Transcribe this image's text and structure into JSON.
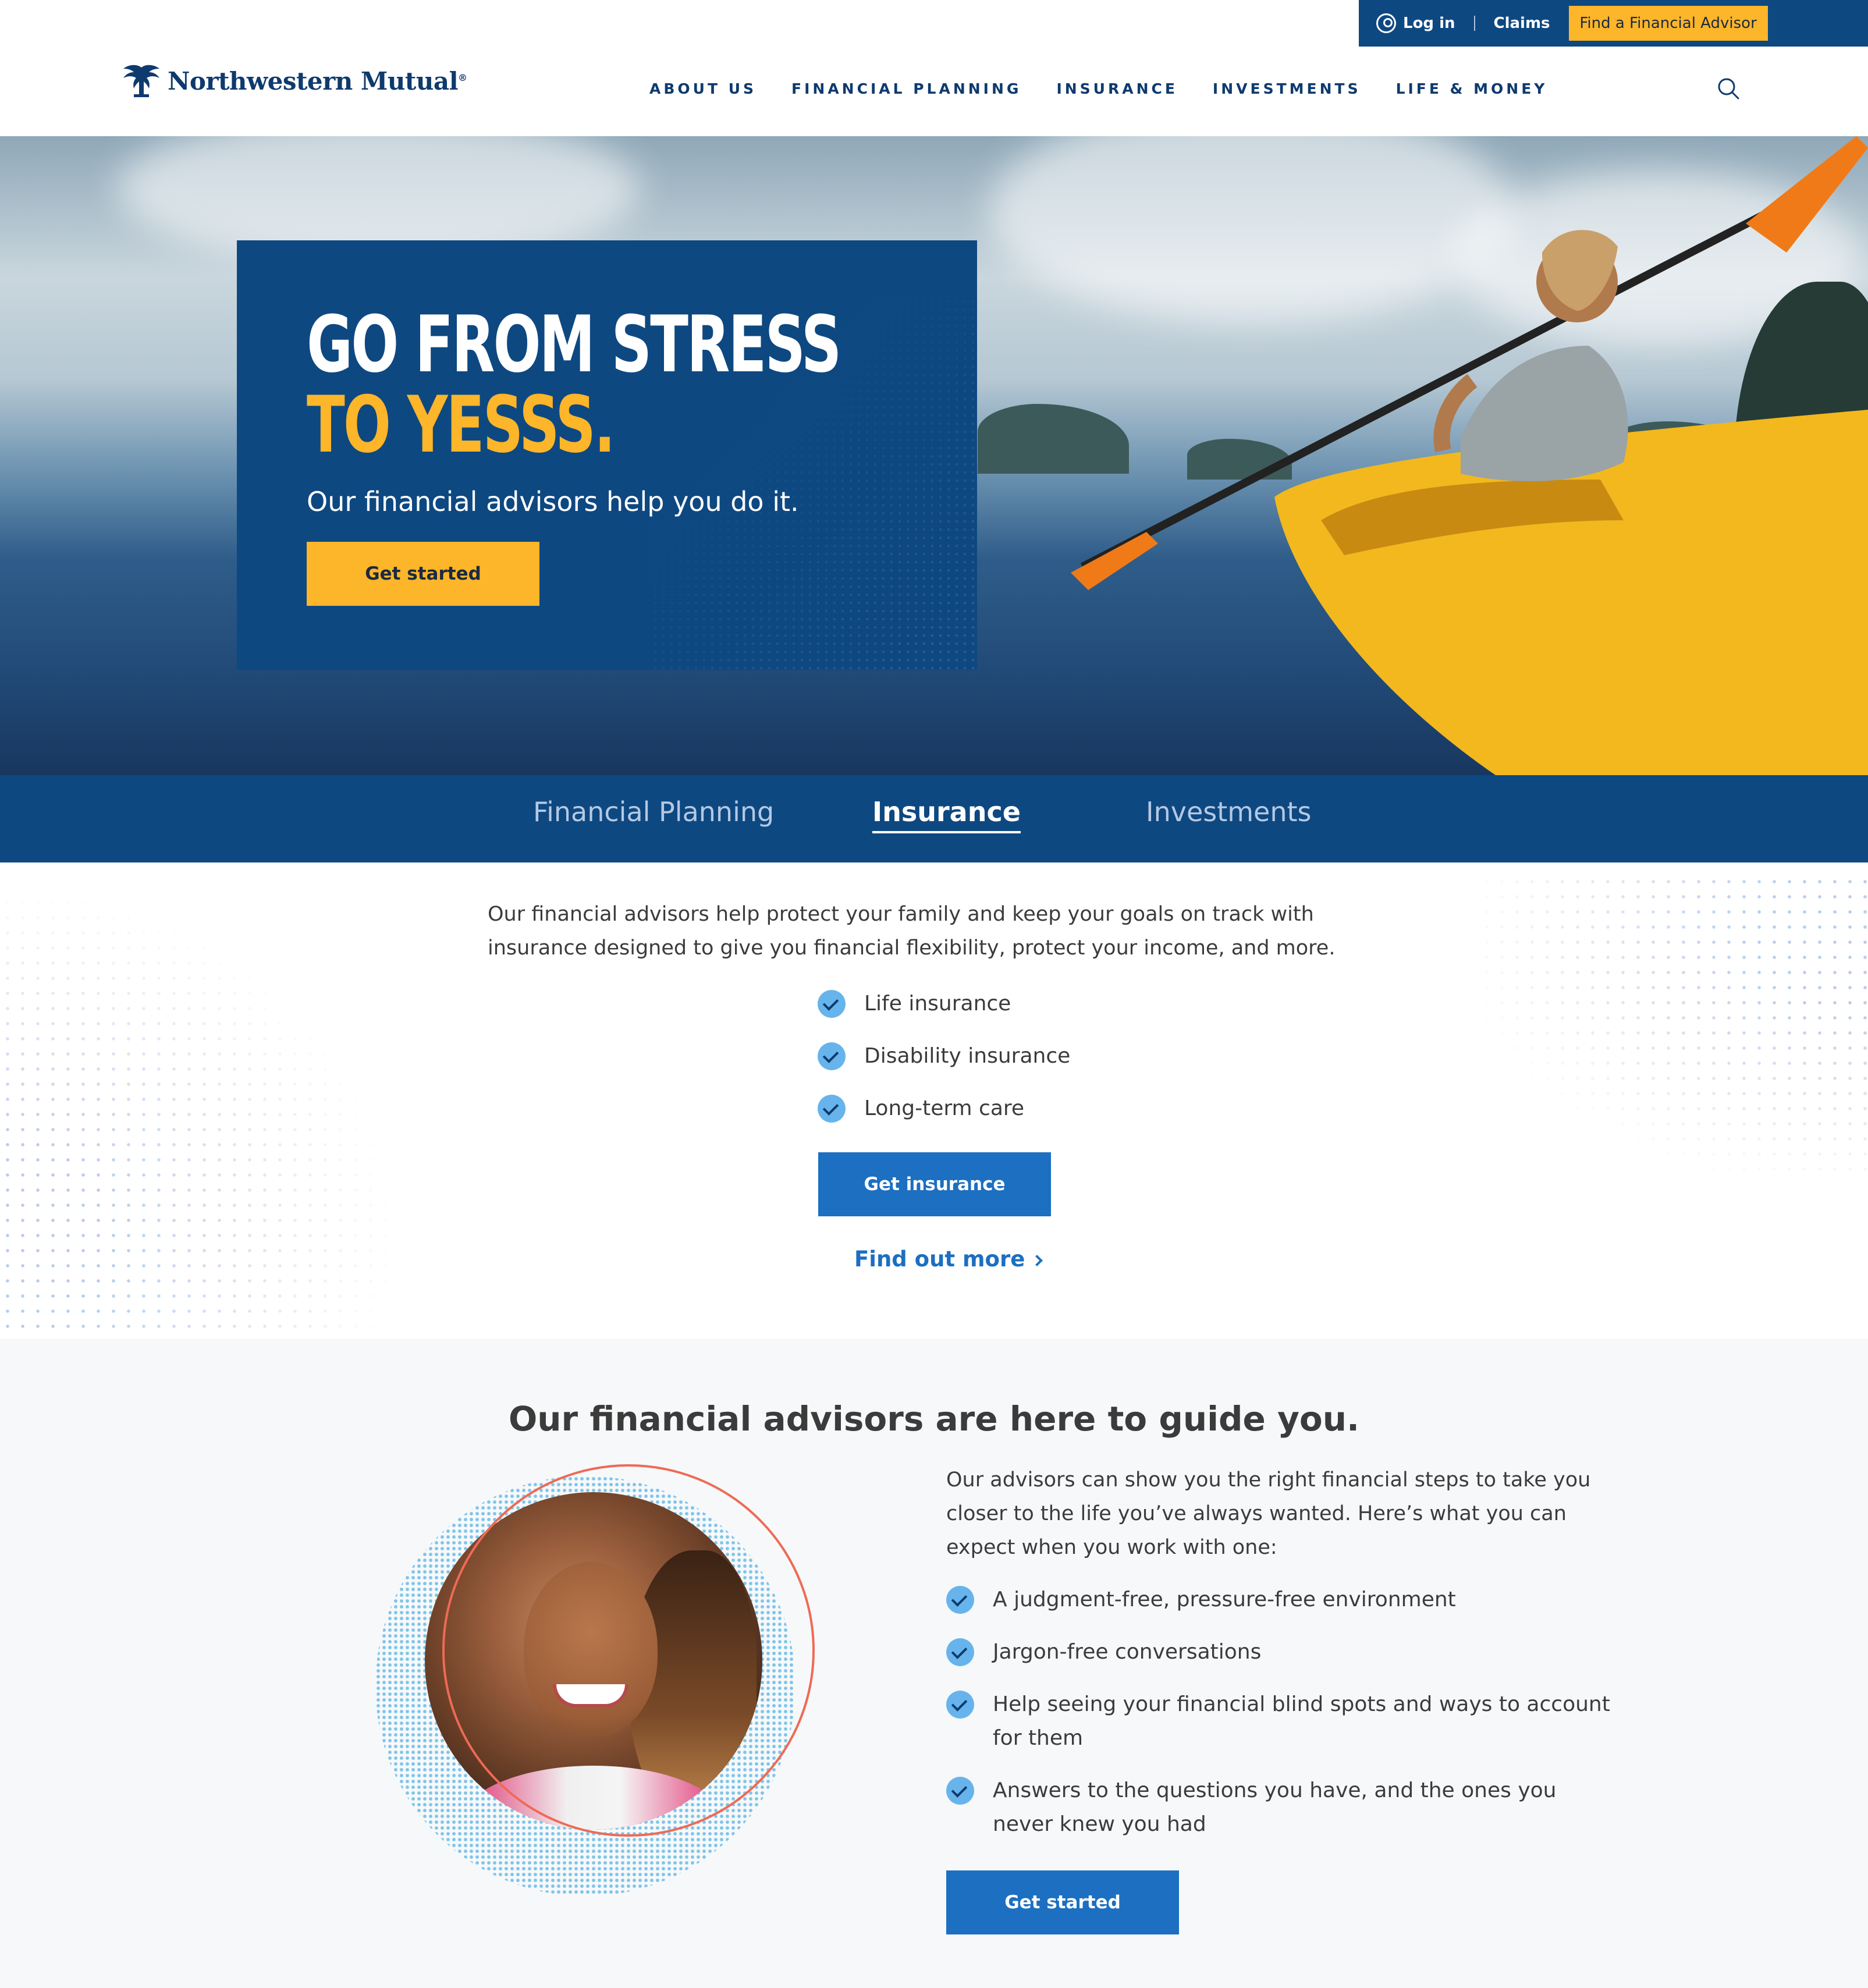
{
  "utility": {
    "login_label": "Log in",
    "claims_label": "Claims",
    "find_advisor_label": "Find a Financial Advisor"
  },
  "brand": {
    "name": "Northwestern Mutual",
    "trademark": "®"
  },
  "nav": {
    "items": [
      {
        "label": "ABOUT US"
      },
      {
        "label": "FINANCIAL PLANNING"
      },
      {
        "label": "INSURANCE"
      },
      {
        "label": "INVESTMENTS"
      },
      {
        "label": "LIFE & MONEY"
      }
    ],
    "search_icon": "search-icon"
  },
  "hero": {
    "title_line1": "GO FROM STRESS",
    "title_line2": "TO YESSS.",
    "subtitle": "Our financial advisors help you do it.",
    "cta_label": "Get started"
  },
  "tabs": {
    "items": [
      {
        "label": "Financial Planning"
      },
      {
        "label": "Insurance"
      },
      {
        "label": "Investments"
      }
    ],
    "active": "Insurance"
  },
  "insurance": {
    "intro": "Our financial advisors help protect your family and keep your goals on track with insurance designed to give you financial flexibility, protect your income, and more.",
    "items": [
      {
        "label": "Life insurance"
      },
      {
        "label": "Disability insurance"
      },
      {
        "label": "Long-term care"
      }
    ],
    "cta_label": "Get insurance",
    "link_label": "Find out more"
  },
  "advisors": {
    "title": "Our financial advisors are here to guide you.",
    "intro": "Our advisors can show you the right financial steps to take you closer to the life you’ve always wanted. Here’s what you can expect when you work with one:",
    "items": [
      {
        "label": "A judgment-free, pressure-free environment"
      },
      {
        "label": "Jargon-free conversations"
      },
      {
        "label": "Help seeing your financial blind spots and ways to account for them"
      },
      {
        "label": "Answers to the questions you have, and the ones you never knew you had"
      }
    ],
    "cta_label": "Get started"
  },
  "colors": {
    "brand_blue": "#0e4881",
    "accent_yellow": "#fdb529",
    "button_blue": "#1c6fc1",
    "check_blue": "#67b4ec",
    "ring_coral": "#ee6a55"
  }
}
